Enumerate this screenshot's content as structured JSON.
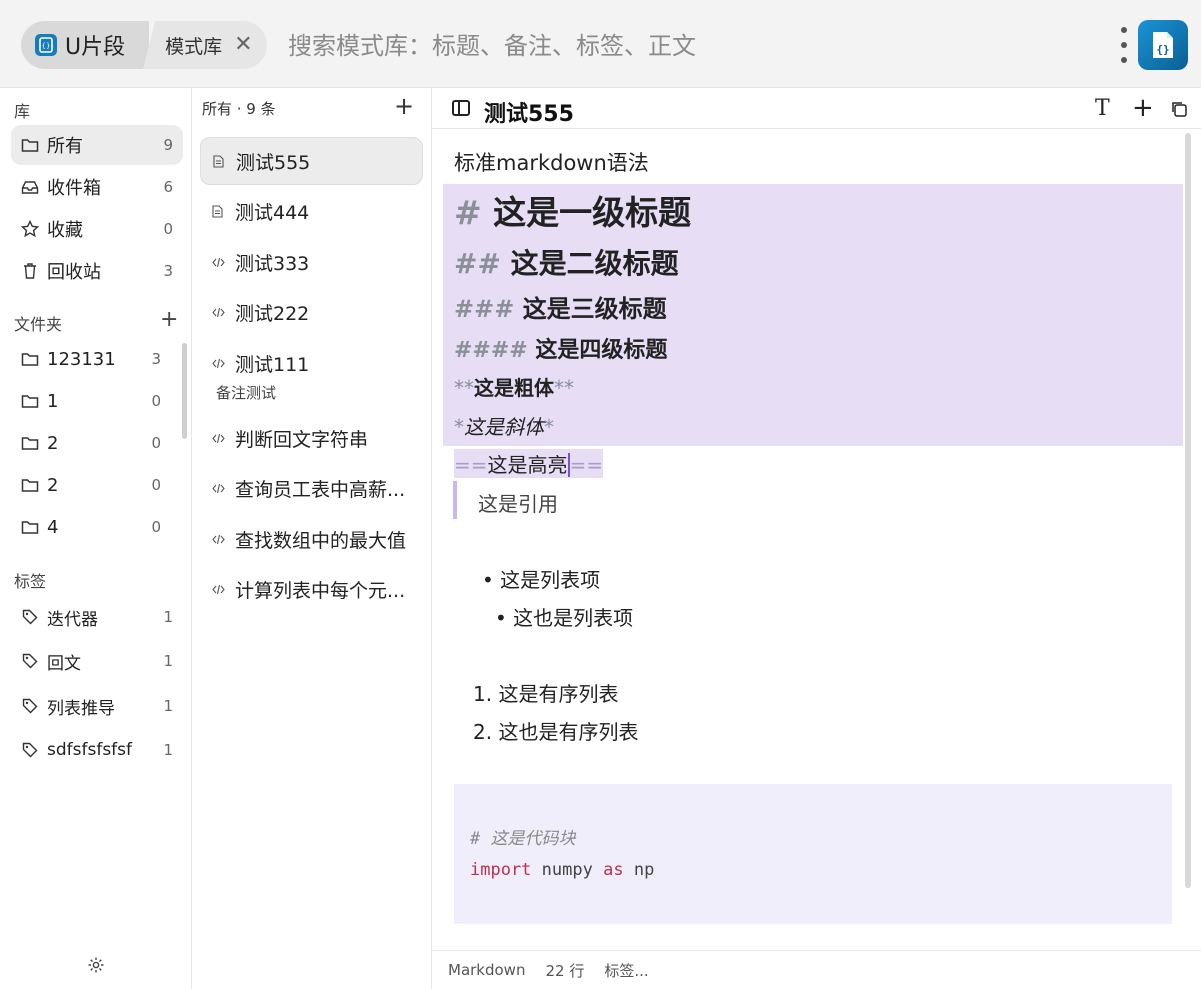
{
  "header": {
    "app_name": "U片段",
    "library_crumb": "模式库",
    "close_glyph": "✕",
    "search_placeholder": "搜索模式库：标题、备注、标签、正文"
  },
  "sidebar": {
    "library_title": "库",
    "library_items": [
      {
        "label": "所有",
        "count": "9",
        "icon": "folder-icon",
        "active": true
      },
      {
        "label": "收件箱",
        "count": "6",
        "icon": "inbox-icon"
      },
      {
        "label": "收藏",
        "count": "0",
        "icon": "star-icon"
      },
      {
        "label": "回收站",
        "count": "3",
        "icon": "trash-icon"
      }
    ],
    "folders_title": "文件夹",
    "folders_add": "+",
    "folders": [
      {
        "label": "123131",
        "count": "3"
      },
      {
        "label": "1",
        "count": "0"
      },
      {
        "label": "2",
        "count": "0"
      },
      {
        "label": "2",
        "count": "0"
      },
      {
        "label": "4",
        "count": "0"
      }
    ],
    "tags_title": "标签",
    "tags": [
      {
        "label": "迭代器",
        "count": "1"
      },
      {
        "label": "回文",
        "count": "1"
      },
      {
        "label": "列表推导",
        "count": "1"
      },
      {
        "label": "sdfsfsfsfsf",
        "count": "1"
      }
    ]
  },
  "list": {
    "header": "所有 · 9 条",
    "add": "+",
    "items": [
      {
        "title": "测试555",
        "icon": "document-icon",
        "active": true
      },
      {
        "title": "测试444",
        "icon": "document-icon"
      },
      {
        "title": "测试333",
        "icon": "code-icon"
      },
      {
        "title": "测试222",
        "icon": "code-icon"
      },
      {
        "title": "测试111",
        "icon": "code-icon",
        "note": "备注测试"
      },
      {
        "title": "判断回文字符串",
        "icon": "code-icon"
      },
      {
        "title": "查询员工表中高薪...",
        "icon": "code-icon"
      },
      {
        "title": "查找数组中的最大值",
        "icon": "code-icon"
      },
      {
        "title": "计算列表中每个元...",
        "icon": "code-icon"
      }
    ]
  },
  "editor": {
    "title": "测试555",
    "toolbar": {
      "format": "T",
      "add": "+"
    },
    "lines": {
      "intro": "标准markdown语法",
      "h1_mark": "#",
      "h1_text": "这是一级标题",
      "h2_mark": "##",
      "h2_text": "这是二级标题",
      "h3_mark": "###",
      "h3_text": "这是三级标题",
      "h4_mark": "####",
      "h4_text": "这是四级标题",
      "bold_mark": "**",
      "bold_text": "这是粗体",
      "italic_mark": "*",
      "italic_text": "这是斜体",
      "hl_mark": "==",
      "hl_text": "这是高亮",
      "quote": "这是引用",
      "ul1": "• 这是列表项",
      "ul2": "• 这也是列表项",
      "ol1": "1. 这是有序列表",
      "ol2": "2. 这也是有序列表",
      "code_comment": "# 这是代码块",
      "code_kw1": "import",
      "code_mod": "numpy",
      "code_kw2": "as",
      "code_alias": "np"
    }
  },
  "status": {
    "language": "Markdown",
    "lines": "22 行",
    "tags": "标签..."
  }
}
